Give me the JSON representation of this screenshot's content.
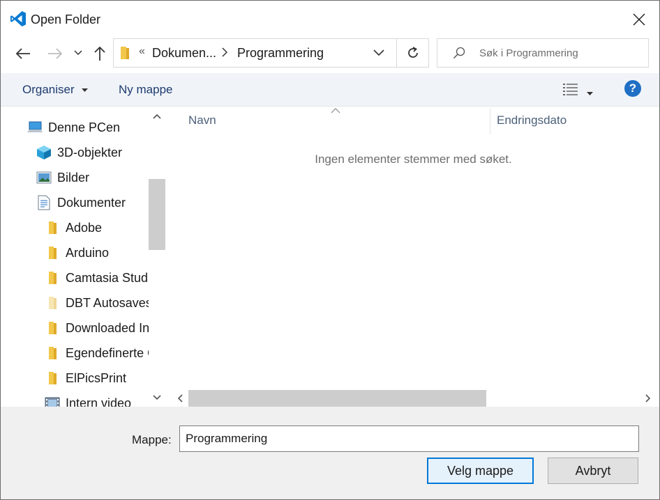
{
  "window": {
    "title": "Open Folder",
    "icon": "vscode-icon",
    "accent": "#0078d7"
  },
  "address_bar": {
    "overflow": "«",
    "crumbs": [
      "Dokumen...",
      "Programmering"
    ]
  },
  "search": {
    "placeholder": "Søk i Programmering"
  },
  "command_bar": {
    "organise_label": "Organiser",
    "new_folder_label": "Ny mappe"
  },
  "nav_tree": {
    "items": [
      {
        "label": "Denne PCen",
        "icon": "computer-icon"
      },
      {
        "label": "3D-objekter",
        "icon": "cube-icon"
      },
      {
        "label": "Bilder",
        "icon": "pictures-icon"
      },
      {
        "label": "Dokumenter",
        "icon": "document-icon"
      },
      {
        "label": "Adobe",
        "icon": "folder-icon"
      },
      {
        "label": "Arduino",
        "icon": "folder-icon"
      },
      {
        "label": "Camtasia Studio",
        "icon": "folder-icon"
      },
      {
        "label": "DBT Autosaves",
        "icon": "folder-faded-icon"
      },
      {
        "label": "Downloaded Installations",
        "icon": "folder-icon"
      },
      {
        "label": "Egendefinerte Office-maler",
        "icon": "folder-icon"
      },
      {
        "label": "ElPicsPrint",
        "icon": "folder-icon"
      },
      {
        "label": "Intern video",
        "icon": "video-icon"
      }
    ]
  },
  "content": {
    "columns": [
      "Navn",
      "Endringsdato"
    ],
    "empty_message": "Ingen elementer stemmer med søket."
  },
  "footer": {
    "folder_label": "Mappe:",
    "folder_value": "Programmering",
    "select_button": "Velg mappe",
    "cancel_button": "Avbryt"
  }
}
